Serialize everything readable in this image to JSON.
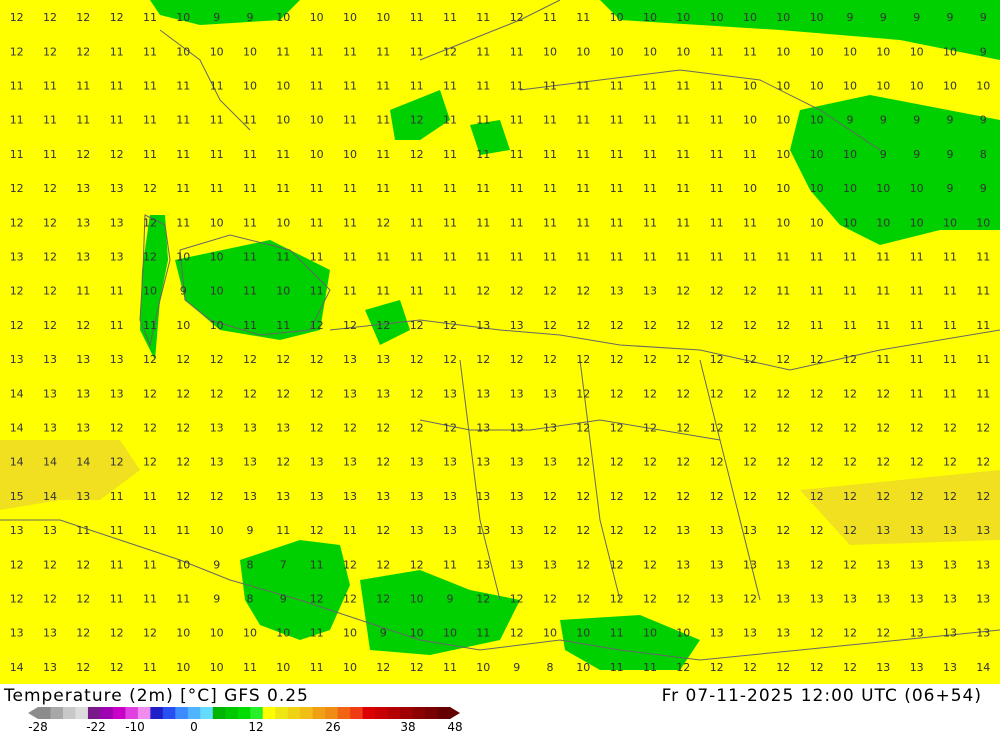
{
  "map": {
    "domain": "Europe",
    "colors": {
      "yellow_13_16": "#ffff00",
      "yellow_light": "#ffff33",
      "orange_band": "#f0e020",
      "green_below_10": "#00cc00",
      "green_dark": "#00a000",
      "border": "#666666"
    },
    "label_grid_values": [
      [
        "12",
        "12",
        "12",
        "12",
        "11",
        "10",
        "9",
        "9",
        "10",
        "10",
        "10",
        "10",
        "11",
        "11",
        "11",
        "12",
        "11",
        "11",
        "10",
        "10",
        "10",
        "10",
        "10",
        "10",
        "10",
        "9",
        "9",
        "9",
        "9",
        "9"
      ],
      [
        "12",
        "12",
        "12",
        "11",
        "11",
        "10",
        "10",
        "10",
        "11",
        "11",
        "11",
        "11",
        "11",
        "12",
        "11",
        "11",
        "10",
        "10",
        "10",
        "10",
        "10",
        "11",
        "11",
        "10",
        "10",
        "10",
        "10",
        "10",
        "10",
        "9"
      ],
      [
        "11",
        "11",
        "11",
        "11",
        "11",
        "11",
        "11",
        "10",
        "10",
        "11",
        "11",
        "11",
        "11",
        "11",
        "11",
        "11",
        "11",
        "11",
        "11",
        "11",
        "11",
        "11",
        "10",
        "10",
        "10",
        "10",
        "10",
        "10",
        "10",
        "10"
      ],
      [
        "11",
        "11",
        "11",
        "11",
        "11",
        "11",
        "11",
        "11",
        "10",
        "10",
        "11",
        "11",
        "12",
        "11",
        "11",
        "11",
        "11",
        "11",
        "11",
        "11",
        "11",
        "11",
        "10",
        "10",
        "10",
        "9",
        "9",
        "9",
        "9",
        "9"
      ],
      [
        "11",
        "11",
        "12",
        "12",
        "11",
        "11",
        "11",
        "11",
        "11",
        "10",
        "10",
        "11",
        "12",
        "11",
        "11",
        "11",
        "11",
        "11",
        "11",
        "11",
        "11",
        "11",
        "11",
        "10",
        "10",
        "10",
        "9",
        "9",
        "9",
        "8"
      ],
      [
        "12",
        "12",
        "13",
        "13",
        "12",
        "11",
        "11",
        "11",
        "11",
        "11",
        "11",
        "11",
        "11",
        "11",
        "11",
        "11",
        "11",
        "11",
        "11",
        "11",
        "11",
        "11",
        "10",
        "10",
        "10",
        "10",
        "10",
        "10",
        "9",
        "9"
      ],
      [
        "12",
        "12",
        "13",
        "13",
        "12",
        "11",
        "10",
        "11",
        "10",
        "11",
        "11",
        "12",
        "11",
        "11",
        "11",
        "11",
        "11",
        "11",
        "11",
        "11",
        "11",
        "11",
        "11",
        "10",
        "10",
        "10",
        "10",
        "10",
        "10",
        "10"
      ],
      [
        "13",
        "12",
        "13",
        "13",
        "12",
        "10",
        "10",
        "11",
        "11",
        "11",
        "11",
        "11",
        "11",
        "11",
        "11",
        "11",
        "11",
        "11",
        "11",
        "11",
        "11",
        "11",
        "11",
        "11",
        "11",
        "11",
        "11",
        "11",
        "11",
        "11"
      ],
      [
        "12",
        "12",
        "11",
        "11",
        "10",
        "9",
        "10",
        "11",
        "10",
        "11",
        "11",
        "11",
        "11",
        "11",
        "12",
        "12",
        "12",
        "12",
        "13",
        "13",
        "12",
        "12",
        "12",
        "11",
        "11",
        "11",
        "11",
        "11",
        "11",
        "11"
      ],
      [
        "12",
        "12",
        "12",
        "11",
        "11",
        "10",
        "10",
        "11",
        "11",
        "12",
        "12",
        "12",
        "12",
        "12",
        "13",
        "13",
        "12",
        "12",
        "12",
        "12",
        "12",
        "12",
        "12",
        "12",
        "11",
        "11",
        "11",
        "11",
        "11",
        "11"
      ],
      [
        "13",
        "13",
        "13",
        "13",
        "12",
        "12",
        "12",
        "12",
        "12",
        "12",
        "13",
        "13",
        "12",
        "12",
        "12",
        "12",
        "12",
        "12",
        "12",
        "12",
        "12",
        "12",
        "12",
        "12",
        "12",
        "12",
        "11",
        "11",
        "11",
        "11"
      ],
      [
        "14",
        "13",
        "13",
        "13",
        "12",
        "12",
        "12",
        "12",
        "12",
        "12",
        "13",
        "13",
        "12",
        "13",
        "13",
        "13",
        "13",
        "12",
        "12",
        "12",
        "12",
        "12",
        "12",
        "12",
        "12",
        "12",
        "12",
        "11",
        "11",
        "11"
      ],
      [
        "14",
        "13",
        "13",
        "12",
        "12",
        "12",
        "13",
        "13",
        "13",
        "12",
        "12",
        "12",
        "12",
        "12",
        "13",
        "13",
        "13",
        "12",
        "12",
        "12",
        "12",
        "12",
        "12",
        "12",
        "12",
        "12",
        "12",
        "12",
        "12",
        "12"
      ],
      [
        "14",
        "14",
        "14",
        "12",
        "12",
        "12",
        "13",
        "13",
        "12",
        "13",
        "13",
        "12",
        "13",
        "13",
        "13",
        "13",
        "13",
        "12",
        "12",
        "12",
        "12",
        "12",
        "12",
        "12",
        "12",
        "12",
        "12",
        "12",
        "12",
        "12"
      ],
      [
        "15",
        "14",
        "13",
        "11",
        "11",
        "12",
        "12",
        "13",
        "13",
        "13",
        "13",
        "13",
        "13",
        "13",
        "13",
        "13",
        "12",
        "12",
        "12",
        "12",
        "12",
        "12",
        "12",
        "12",
        "12",
        "12",
        "12",
        "12",
        "12",
        "12"
      ],
      [
        "13",
        "13",
        "11",
        "11",
        "11",
        "11",
        "10",
        "9",
        "11",
        "12",
        "11",
        "12",
        "13",
        "13",
        "13",
        "13",
        "12",
        "12",
        "12",
        "12",
        "13",
        "13",
        "13",
        "12",
        "12",
        "12",
        "13",
        "13",
        "13",
        "13"
      ],
      [
        "12",
        "12",
        "12",
        "11",
        "11",
        "10",
        "9",
        "8",
        "7",
        "11",
        "12",
        "12",
        "12",
        "11",
        "13",
        "13",
        "13",
        "12",
        "12",
        "12",
        "13",
        "13",
        "13",
        "13",
        "12",
        "12",
        "13",
        "13",
        "13",
        "13"
      ],
      [
        "12",
        "12",
        "12",
        "11",
        "11",
        "11",
        "9",
        "8",
        "9",
        "12",
        "12",
        "12",
        "10",
        "9",
        "12",
        "12",
        "12",
        "12",
        "12",
        "12",
        "12",
        "13",
        "12",
        "13",
        "13",
        "13",
        "13",
        "13",
        "13",
        "13"
      ],
      [
        "13",
        "13",
        "12",
        "12",
        "12",
        "10",
        "10",
        "10",
        "10",
        "11",
        "10",
        "9",
        "10",
        "10",
        "11",
        "12",
        "10",
        "10",
        "11",
        "10",
        "10",
        "13",
        "13",
        "13",
        "12",
        "12",
        "12",
        "13",
        "13",
        "13"
      ],
      [
        "14",
        "13",
        "12",
        "12",
        "11",
        "10",
        "10",
        "11",
        "10",
        "11",
        "10",
        "12",
        "12",
        "11",
        "10",
        "9",
        "8",
        "10",
        "11",
        "11",
        "12",
        "12",
        "12",
        "12",
        "12",
        "12",
        "13",
        "13",
        "13",
        "14"
      ]
    ]
  },
  "footer": {
    "title_left": "Temperature (2m) [°C] GFS 0.25",
    "title_right": "Fr 07-11-2025 12:00 UTC (06+54)",
    "scale_colors": [
      "#8c8c8c",
      "#a8a8a8",
      "#c8c8c8",
      "#dcdcdc",
      "#7a1a8a",
      "#a000b4",
      "#c800c8",
      "#e040e0",
      "#f08cf0",
      "#2020c8",
      "#2850f0",
      "#3c8cff",
      "#50b4ff",
      "#64dcff",
      "#00b400",
      "#00c800",
      "#00dc00",
      "#28f028",
      "#ffff00",
      "#f0e614",
      "#f0d214",
      "#f0be14",
      "#f0a014",
      "#f08c14",
      "#f06414",
      "#f03c14",
      "#dc0000",
      "#c80000",
      "#b40000",
      "#a00000",
      "#8c0000",
      "#780000",
      "#640000"
    ],
    "scale_labels": [
      "-28",
      "-22",
      "-10",
      "0",
      "12",
      "26",
      "38",
      "48"
    ]
  }
}
